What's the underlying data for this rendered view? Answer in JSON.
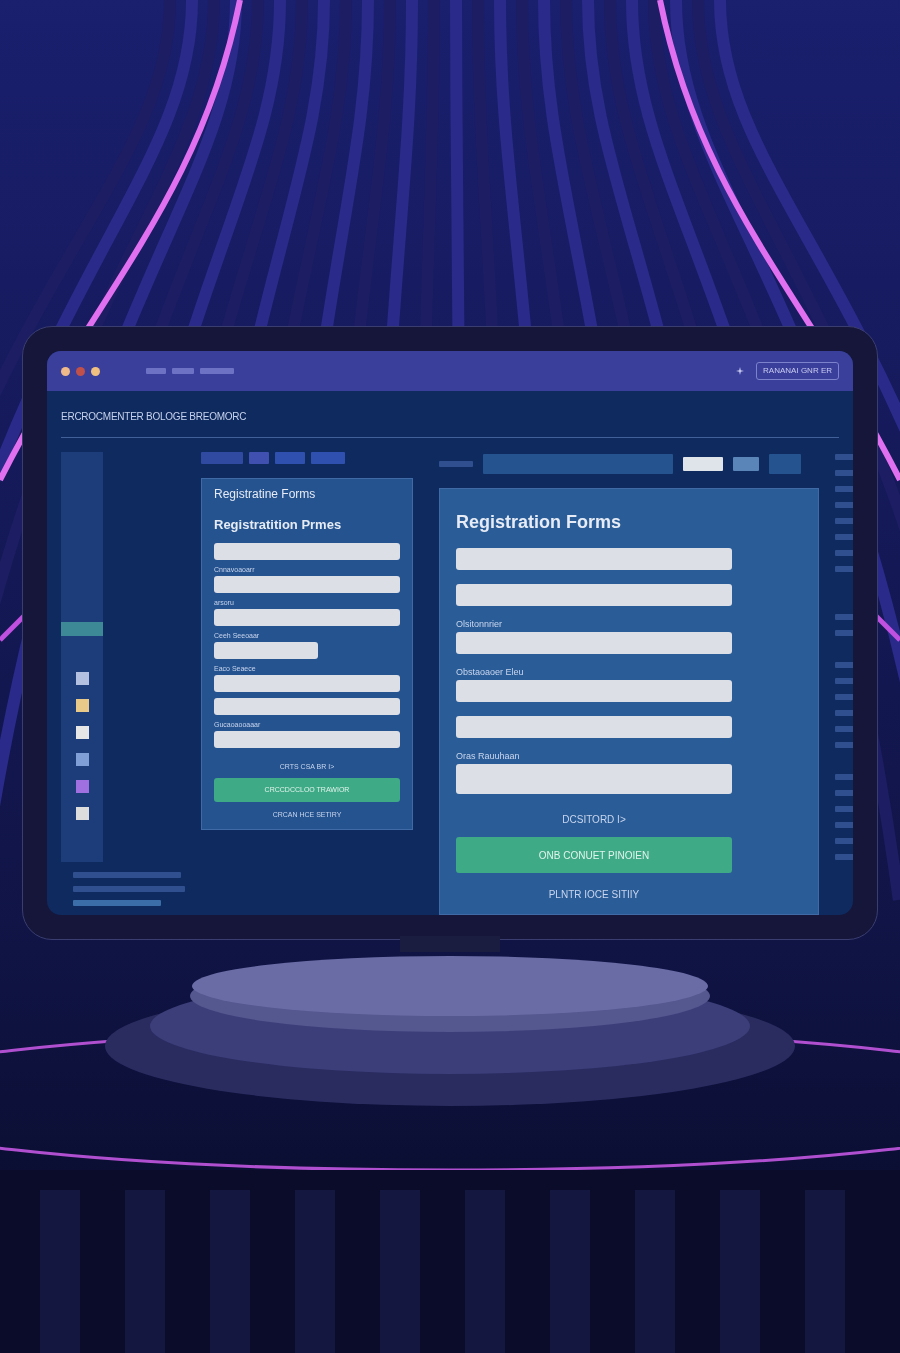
{
  "browser": {
    "address_text": "RANANAI GNR ER"
  },
  "page_header": "ERCROCMENTER BOLOGE BREOMORC",
  "sidebar": {
    "swatches": [
      {
        "color": "#b4c0e0"
      },
      {
        "color": "#e8c98a"
      },
      {
        "color": "#e6e6e6"
      },
      {
        "color": "#7f9fd6"
      },
      {
        "color": "#a070e0"
      },
      {
        "color": "#dddddd"
      }
    ]
  },
  "left_form": {
    "subtitle": "Registratine Forms",
    "title": "Registratition Prmes",
    "fields": [
      {
        "kind": "full"
      },
      {
        "kind": "full",
        "label": "Cnnavoaoarr"
      },
      {
        "kind": "full",
        "label": "arsoru"
      },
      {
        "kind": "short",
        "label": "Ceeh Seeoaar"
      },
      {
        "kind": "full",
        "label": "Eaco Seaece"
      },
      {
        "kind": "full"
      },
      {
        "kind": "full",
        "label": "Gucaoaooaaar"
      }
    ],
    "note": "CRTS CSA BR I>",
    "button": "CRCCDCCLOO TRAWIOR",
    "link": "CRCAN HCE SETIRY"
  },
  "main_form": {
    "title": "Registration Forms",
    "fields": [
      {
        "kind": "full"
      },
      {
        "kind": "full"
      },
      {
        "kind": "full",
        "label": "Olsitonnrier"
      },
      {
        "kind": "full",
        "label": "Obstaoaoer Eleu"
      },
      {
        "kind": "full"
      },
      {
        "kind": "tall",
        "label": "Oras Rauuhaan"
      }
    ],
    "note": "DCSITORD I>",
    "button": "ONB CONUET PINOIEN",
    "link": "PLNTR IOCE SITIIY"
  }
}
